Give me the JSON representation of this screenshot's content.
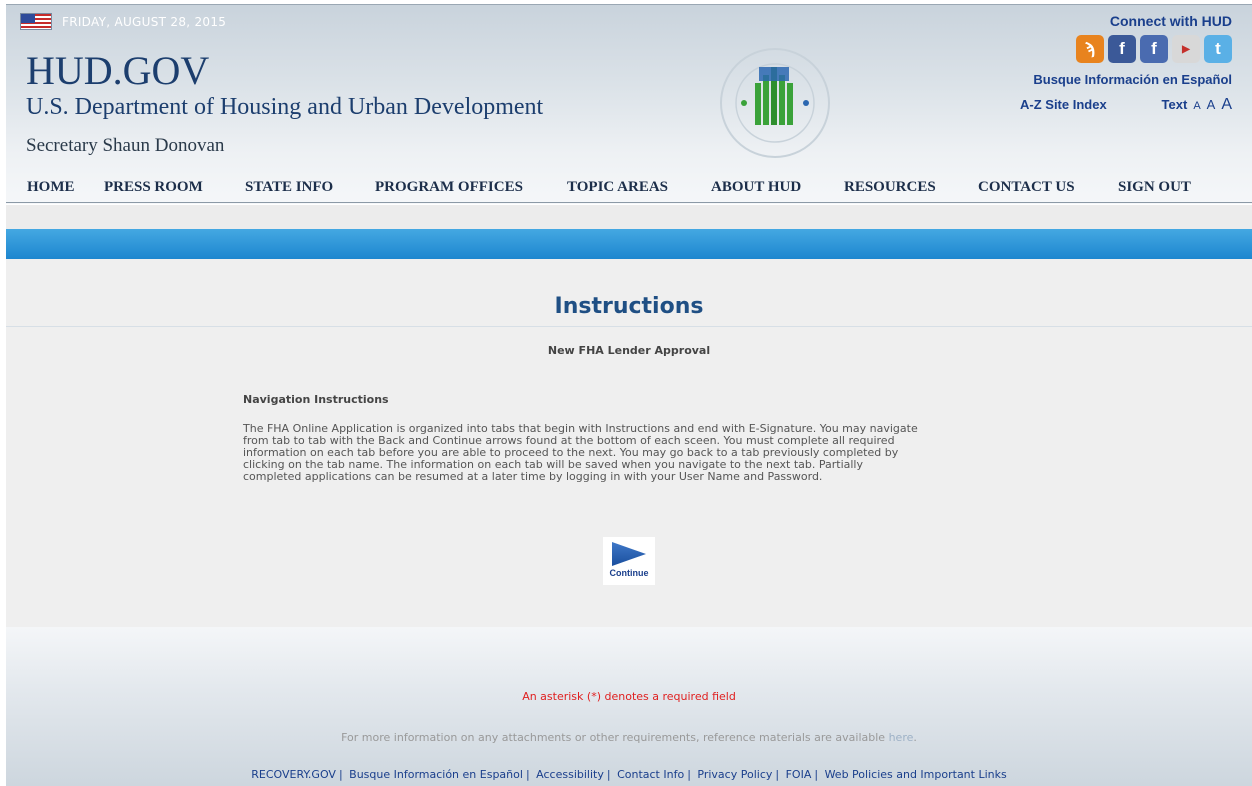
{
  "header": {
    "date": "FRIDAY, AUGUST 28, 2015",
    "site_title": "HUD.GOV",
    "department": "U.S. Department of Housing and Urban Development",
    "secretary": "Secretary Shaun Donovan",
    "connect": "Connect with HUD",
    "busque": "Busque Información en Español",
    "site_index": "A-Z Site Index",
    "text_label": "Text",
    "text_sizes": [
      "A",
      "A",
      "A"
    ],
    "social_icons": [
      "rss-icon",
      "facebook-icon",
      "facebook-icon",
      "youtube-icon",
      "twitter-icon"
    ]
  },
  "nav": {
    "items": [
      "HOME",
      "PRESS ROOM",
      "STATE INFO",
      "PROGRAM OFFICES",
      "TOPIC AREAS",
      "ABOUT HUD",
      "RESOURCES",
      "CONTACT US",
      "SIGN OUT"
    ]
  },
  "main": {
    "title": "Instructions",
    "subtitle": "New FHA Lender Approval",
    "section_heading": "Navigation Instructions",
    "body_lines": [
      "The FHA Online Application is organized into tabs that begin with Instructions and end with E-Signature. You may navigate",
      "from tab to tab with the Back and Continue arrows found at the bottom of each sceen. You must complete all required",
      "information on each tab before you are able to proceed to the next. You may go back to a tab previously completed by",
      "clicking on the tab name. The information on each tab will be saved when you navigate to the next tab. Partially",
      "completed applications can be resumed at a later time by logging in with your User Name and Password."
    ],
    "continue_label": "Continue"
  },
  "footer": {
    "required_note": "An asterisk (*) denotes a required field",
    "more_info_prefix": "For more information on any attachments or other requirements, reference materials are available ",
    "more_info_link": "here",
    "more_info_suffix": ".",
    "links": [
      "RECOVERY.GOV",
      "Busque Información en Español",
      "Accessibility",
      "Contact Info",
      "Privacy Policy",
      "FOIA",
      "Web Policies and Important Links"
    ]
  },
  "colors": {
    "brand_blue": "#1c3e6e",
    "link_blue": "#1a3f8c",
    "accent_bar": "#1d86cf",
    "required_red": "#e02020"
  }
}
